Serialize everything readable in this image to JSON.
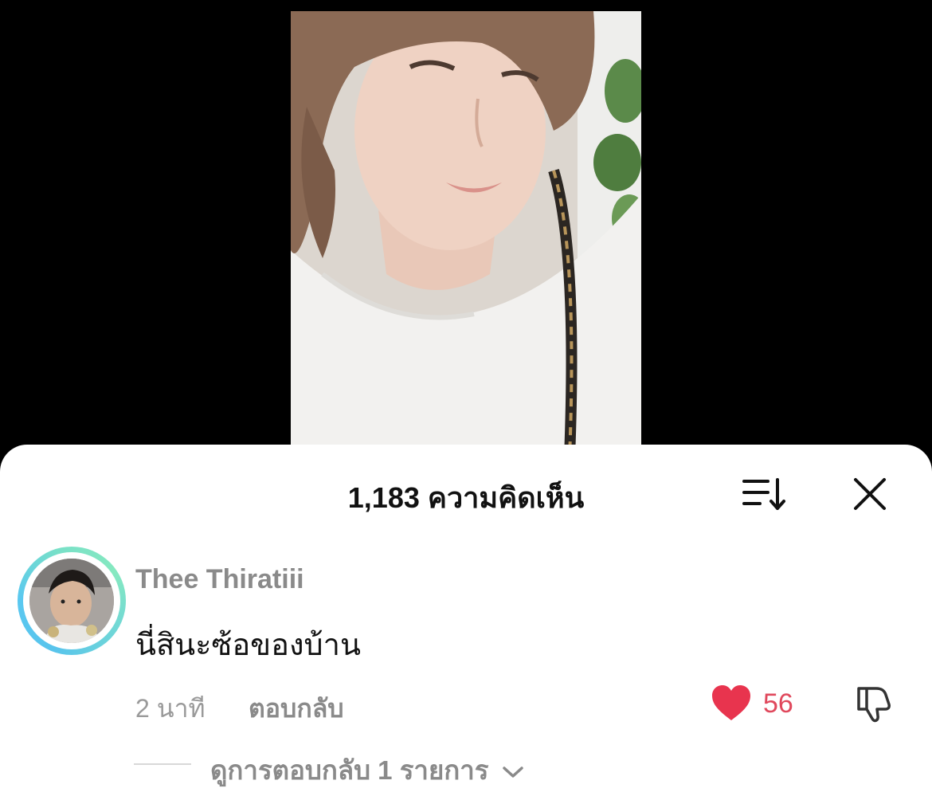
{
  "video": {
    "image_name": "video-frame-person"
  },
  "comments_sheet": {
    "title": "1,183 ความคิดเห็น",
    "sort_icon": "sort-icon",
    "close_icon": "close-icon"
  },
  "comment": {
    "username": "Thee Thiratiii",
    "text": "นี่สินะซ้อของบ้าน",
    "time": "2 นาที",
    "reply_label": "ตอบกลับ",
    "like_count": "56",
    "like_color": "#e8344e",
    "view_replies_label": "ดูการตอบกลับ 1 รายการ"
  }
}
